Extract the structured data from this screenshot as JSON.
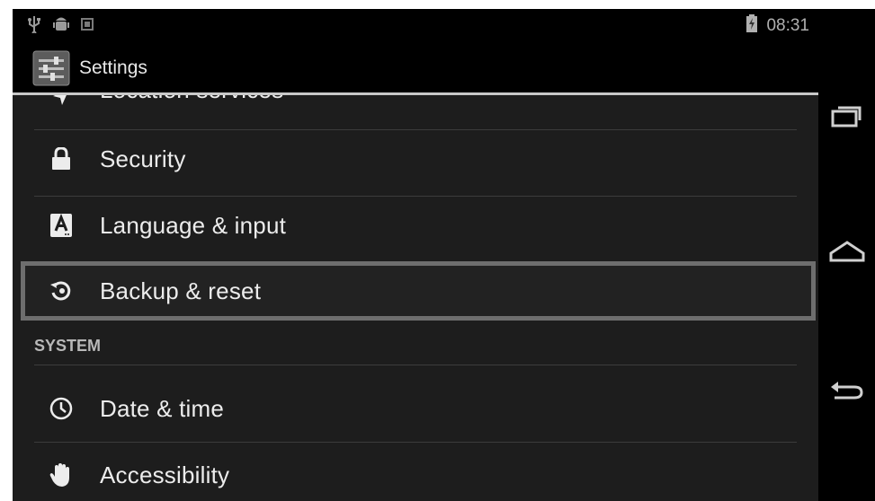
{
  "status_bar": {
    "time": "08:31",
    "icons": [
      "usb-icon",
      "android-debug-icon",
      "notification-icon",
      "battery-icon"
    ]
  },
  "action_bar": {
    "title": "Settings",
    "icon": "settings-app-icon"
  },
  "list": {
    "partial_item": {
      "label": "Location services",
      "icon": "location-icon"
    },
    "items_personal": [
      {
        "label": "Security",
        "icon": "lock-icon"
      },
      {
        "label": "Language & input",
        "icon": "language-icon"
      },
      {
        "label": "Backup & reset",
        "icon": "backup-restore-icon",
        "selected": true
      }
    ],
    "section_system": "SYSTEM",
    "items_system": [
      {
        "label": "Date & time",
        "icon": "clock-icon"
      },
      {
        "label": "Accessibility",
        "icon": "hand-icon"
      }
    ]
  },
  "nav_bar": {
    "buttons": [
      "recent-apps-icon",
      "home-icon",
      "back-icon"
    ]
  },
  "colors": {
    "background": "#000000",
    "list_background": "#1d1d1d",
    "selected_border": "#6e6e6e",
    "text": "#ececec"
  }
}
